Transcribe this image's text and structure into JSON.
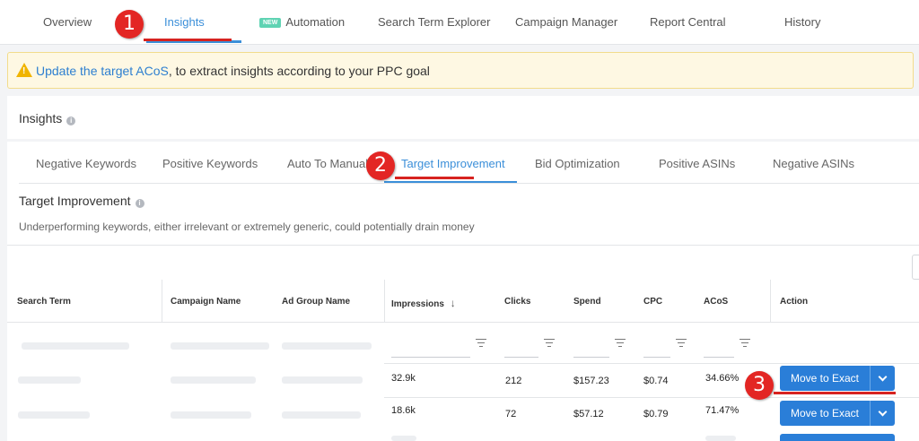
{
  "nav": {
    "tabs": [
      {
        "label": "Overview"
      },
      {
        "label": "Insights"
      },
      {
        "label": "Automation",
        "badge": "NEW"
      },
      {
        "label": "Search Term Explorer"
      },
      {
        "label": "Campaign Manager"
      },
      {
        "label": "Report Central"
      },
      {
        "label": "History"
      }
    ],
    "active_tab": "Insights"
  },
  "banner": {
    "link_text": "Update the target ACoS",
    "rest_text": ", to extract insights according to your PPC goal",
    "icon": "warning-icon"
  },
  "insights": {
    "title": "Insights",
    "info_icon": "info-icon",
    "subtabs": [
      {
        "label": "Negative Keywords"
      },
      {
        "label": "Positive Keywords"
      },
      {
        "label": "Auto To Manual"
      },
      {
        "label": "Target Improvement"
      },
      {
        "label": "Bid Optimization"
      },
      {
        "label": "Positive ASINs"
      },
      {
        "label": "Negative ASINs"
      }
    ],
    "active_subtab": "Target Improvement"
  },
  "section": {
    "title": "Target Improvement",
    "description": "Underperforming keywords, either irrelevant or extremely generic, could potentially drain money"
  },
  "table": {
    "headers": {
      "search_term": "Search Term",
      "campaign_name": "Campaign Name",
      "ad_group_name": "Ad Group Name",
      "impressions": "Impressions",
      "clicks": "Clicks",
      "spend": "Spend",
      "cpc": "CPC",
      "acos": "ACoS",
      "action": "Action"
    },
    "sort_icon": "arrow-down-icon",
    "rows": [
      {
        "impressions": "32.9k",
        "clicks": "212",
        "spend": "$157.23",
        "cpc": "$0.74",
        "acos": "34.66%",
        "action": "Move to Exact"
      },
      {
        "impressions": "18.6k",
        "clicks": "72",
        "spend": "$57.12",
        "cpc": "$0.79",
        "acos": "71.47%",
        "action": "Move to Exact"
      }
    ]
  },
  "annotations": {
    "step1": "1",
    "step2": "2",
    "step3": "3",
    "color": "#e32624"
  },
  "colors": {
    "accent": "#3b8fd9",
    "button": "#2a7ed8",
    "banner_bg": "#fef8e3",
    "badge": "#5fd3b3"
  }
}
